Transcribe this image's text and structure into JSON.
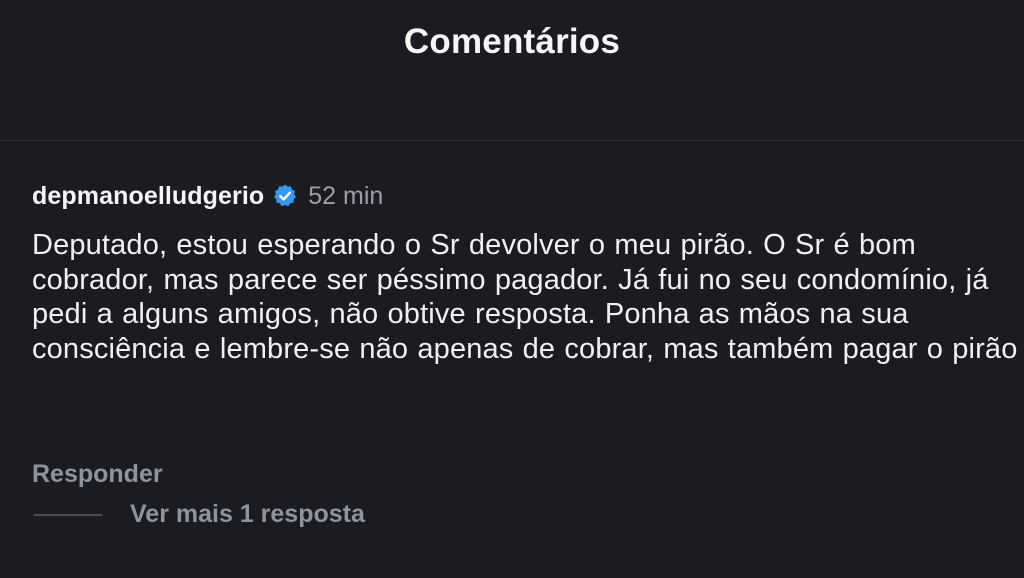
{
  "header": {
    "title": "Comentários"
  },
  "comment": {
    "username": "depmanoelludgerio",
    "verified_icon": "verified-badge-icon",
    "time": "52 min",
    "text": "Deputado, estou esperando o Sr devolver o meu pirão. O Sr é bom cobrador, mas parece ser péssimo pagador. Já fui no seu condomínio, já pedi a alguns amigos, não obtive resposta. Ponha as mãos na sua consciência e lembre-se não apenas de cobrar, mas também pagar o pirão",
    "reply_label": "Responder",
    "view_replies_label": "Ver mais 1 resposta"
  },
  "colors": {
    "background": "#1b1c22",
    "verified_blue": "#3897f0",
    "muted_text": "#8f939c"
  }
}
